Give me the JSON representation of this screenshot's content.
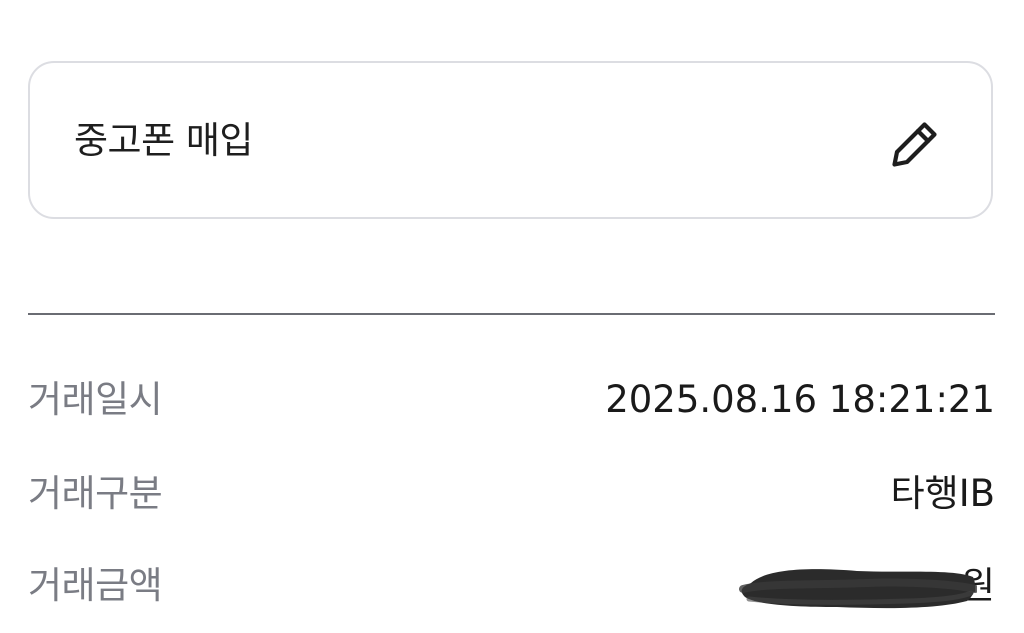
{
  "memo": {
    "text": "중고폰 매입",
    "edit_icon": "pencil-icon"
  },
  "details": [
    {
      "label": "거래일시",
      "value": "2025.08.16 18:21:21"
    },
    {
      "label": "거래구분",
      "value": "타행IB"
    },
    {
      "label": "거래금액",
      "value": "원",
      "value_redacted": true
    }
  ],
  "colors": {
    "label": "#7a7c84",
    "value": "#1a1a1a",
    "card_border": "#dcdde2",
    "divider": "#6a6c73",
    "redaction": "#2b2b2b"
  }
}
